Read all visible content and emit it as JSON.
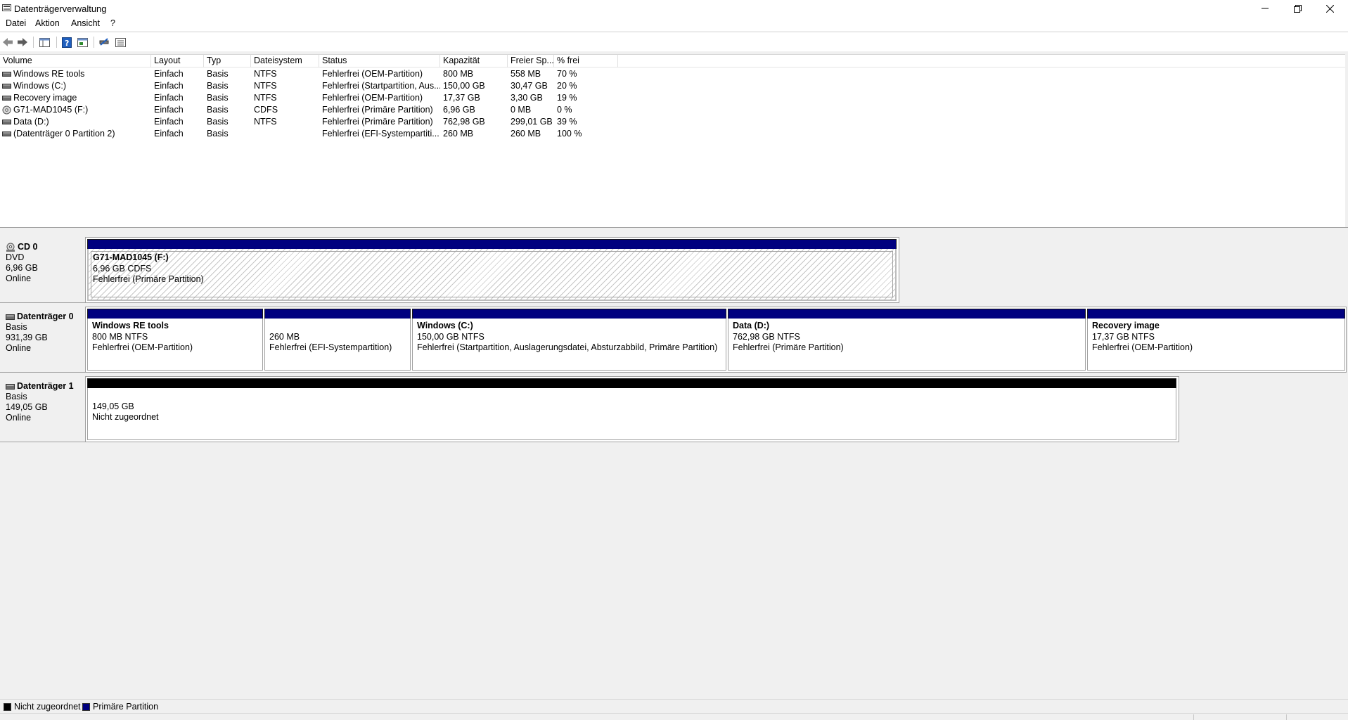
{
  "window": {
    "title": "Datenträgerverwaltung"
  },
  "menu": {
    "items": [
      "Datei",
      "Aktion",
      "Ansicht",
      "?"
    ]
  },
  "list": {
    "columns": [
      "Volume",
      "Layout",
      "Typ",
      "Dateisystem",
      "Status",
      "Kapazität",
      "Freier Sp...",
      "% frei"
    ],
    "rows": [
      {
        "icon": "drive-icon",
        "volume": "Windows RE tools",
        "layout": "Einfach",
        "typ": "Basis",
        "fs": "NTFS",
        "status": "Fehlerfrei (OEM-Partition)",
        "capacity": "800 MB",
        "free": "558 MB",
        "pct": "70 %"
      },
      {
        "icon": "drive-icon",
        "volume": "Windows (C:)",
        "layout": "Einfach",
        "typ": "Basis",
        "fs": "NTFS",
        "status": "Fehlerfrei (Startpartition, Aus...",
        "capacity": "150,00 GB",
        "free": "30,47 GB",
        "pct": "20 %"
      },
      {
        "icon": "drive-icon",
        "volume": "Recovery image",
        "layout": "Einfach",
        "typ": "Basis",
        "fs": "NTFS",
        "status": "Fehlerfrei (OEM-Partition)",
        "capacity": "17,37 GB",
        "free": "3,30 GB",
        "pct": "19 %"
      },
      {
        "icon": "cd-icon",
        "volume": "G71-MAD1045 (F:)",
        "layout": "Einfach",
        "typ": "Basis",
        "fs": "CDFS",
        "status": "Fehlerfrei (Primäre Partition)",
        "capacity": "6,96 GB",
        "free": "0 MB",
        "pct": "0 %"
      },
      {
        "icon": "drive-icon",
        "volume": "Data (D:)",
        "layout": "Einfach",
        "typ": "Basis",
        "fs": "NTFS",
        "status": "Fehlerfrei (Primäre Partition)",
        "capacity": "762,98 GB",
        "free": "299,01 GB",
        "pct": "39 %"
      },
      {
        "icon": "drive-icon",
        "volume": "(Datenträger 0 Partition 2)",
        "layout": "Einfach",
        "typ": "Basis",
        "fs": "",
        "status": "Fehlerfrei (EFI-Systempartiti...",
        "capacity": "260 MB",
        "free": "260 MB",
        "pct": "100 %"
      }
    ]
  },
  "disks": [
    {
      "name": "CD 0",
      "type": "DVD",
      "size": "6,96 GB",
      "state": "Online",
      "partitions": [
        {
          "name": "G71-MAD1045  (F:)",
          "size": "6,96 GB CDFS",
          "status": "Fehlerfrei (Primäre Partition)"
        }
      ]
    },
    {
      "name": "Datenträger 0",
      "type": "Basis",
      "size": "931,39 GB",
      "state": "Online",
      "partitions": [
        {
          "name": "Windows RE tools",
          "size": "800 MB NTFS",
          "status": "Fehlerfrei (OEM-Partition)"
        },
        {
          "name": "",
          "size": "260 MB",
          "status": "Fehlerfrei (EFI-Systempartition)"
        },
        {
          "name": "Windows  (C:)",
          "size": "150,00 GB NTFS",
          "status": "Fehlerfrei (Startpartition, Auslagerungsdatei, Absturzabbild, Primäre Partition)"
        },
        {
          "name": "Data  (D:)",
          "size": "762,98 GB NTFS",
          "status": "Fehlerfrei (Primäre Partition)"
        },
        {
          "name": "Recovery image",
          "size": "17,37 GB NTFS",
          "status": "Fehlerfrei (OEM-Partition)"
        }
      ]
    },
    {
      "name": "Datenträger 1",
      "type": "Basis",
      "size": "149,05 GB",
      "state": "Online",
      "partitions": [
        {
          "name": "",
          "size": "149,05 GB",
          "status": "Nicht zugeordnet"
        }
      ]
    }
  ],
  "legend": [
    {
      "label": "Nicht zugeordnet",
      "color": "#000000"
    },
    {
      "label": "Primäre Partition",
      "color": "#00007f"
    }
  ]
}
